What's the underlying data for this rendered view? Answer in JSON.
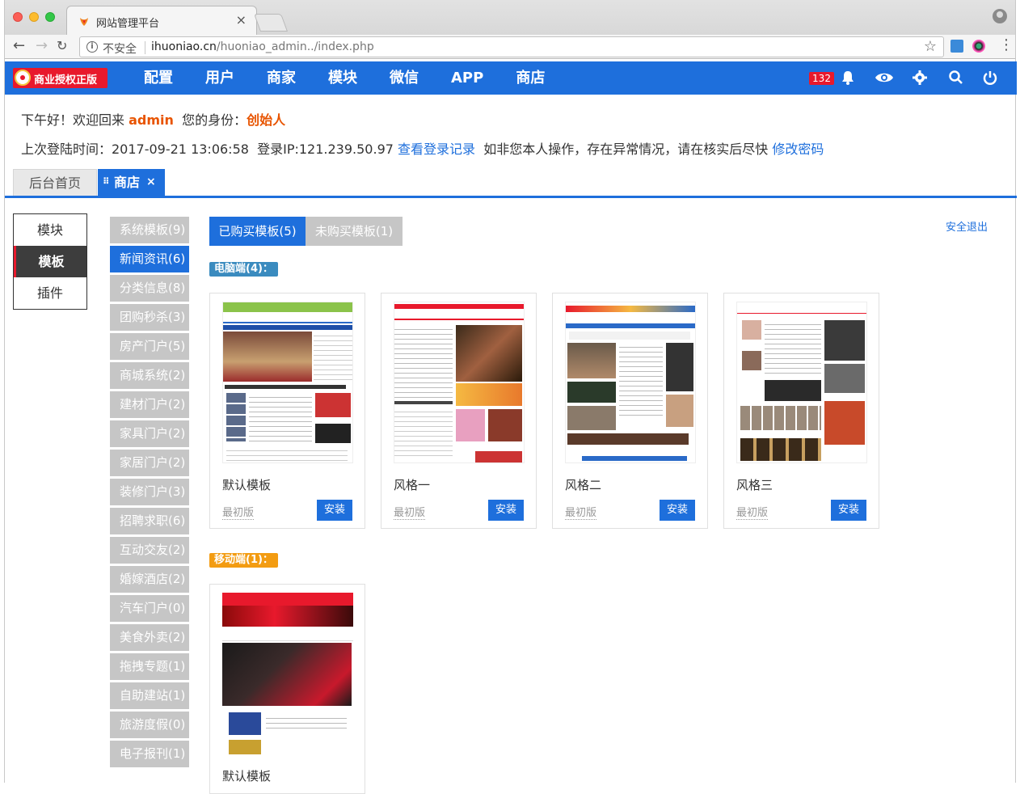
{
  "browser": {
    "tab_title": "网站管理平台",
    "tab_close": "×",
    "security_label": "不安全",
    "url_host": "ihuoniao.cn",
    "url_path": "/huoniao_admin../index.php"
  },
  "header": {
    "license_label": "商业授权正版",
    "nav": [
      "配置",
      "用户",
      "商家",
      "模块",
      "微信",
      "APP",
      "商店"
    ],
    "notification_count": "132"
  },
  "welcome": {
    "greeting_prefix": "下午好！欢迎回来",
    "username": "admin",
    "role_prefix": "您的身份：",
    "role": "创始人",
    "last_login_label": "上次登陆时间：2017-09-21 13:06:58",
    "login_ip_label": "登录IP:121.239.50.97",
    "login_history_link": "查看登录记录",
    "warning_text": "如非您本人操作，存在异常情况，请在核实后尽快",
    "change_password_link": "修改密码"
  },
  "page_tabs": {
    "home_label": "后台首页",
    "current_label": "商店",
    "close": "×"
  },
  "left_nav": [
    "模块",
    "模板",
    "插件"
  ],
  "categories": [
    "系统模板(9)",
    "新闻资讯(6)",
    "分类信息(8)",
    "团购秒杀(3)",
    "房产门户(5)",
    "商城系统(2)",
    "建材门户(2)",
    "家具门户(2)",
    "家居门户(2)",
    "装修门户(3)",
    "招聘求职(6)",
    "互动交友(2)",
    "婚嫁酒店(2)",
    "汽车门户(0)",
    "美食外卖(2)",
    "拖拽专题(1)",
    "自助建站(1)",
    "旅游度假(0)",
    "电子报刊(1)"
  ],
  "content": {
    "purchased_tab": "已购买模板(5)",
    "unpurchased_tab": "未购买模板(1)",
    "logout_link": "安全退出",
    "pc_section": "电脑端(4)：",
    "mobile_section": "移动端(1)：",
    "pc_templates": [
      {
        "name": "默认模板",
        "version": "最初版",
        "button": "安装"
      },
      {
        "name": "风格一",
        "version": "最初版",
        "button": "安装"
      },
      {
        "name": "风格二",
        "version": "最初版",
        "button": "安装"
      },
      {
        "name": "风格三",
        "version": "最初版",
        "button": "安装"
      }
    ],
    "mobile_templates": [
      {
        "name": "默认模板"
      }
    ]
  },
  "colors": {
    "brand_blue": "#1e6fdc",
    "accent_red": "#e8192c",
    "accent_orange": "#e85400"
  }
}
